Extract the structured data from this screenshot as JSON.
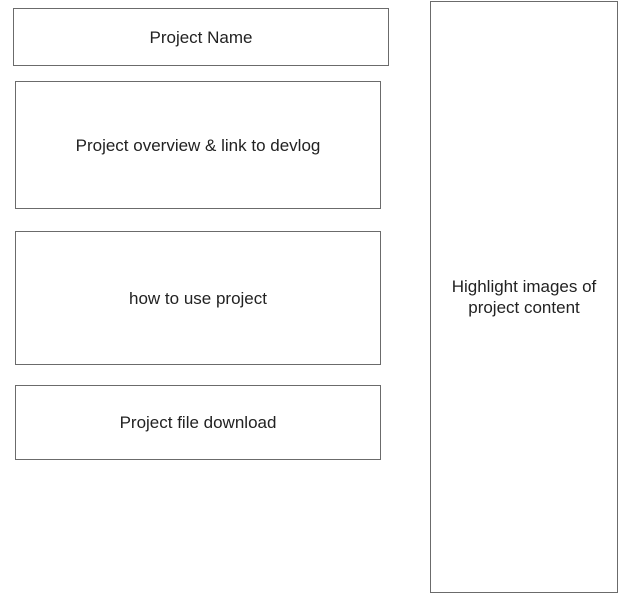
{
  "boxes": {
    "project_name": "Project Name",
    "overview": "Project overview & link to devlog",
    "how_to_use": "how to use project",
    "download": "Project file download",
    "highlight_images": "Highlight images of project content"
  },
  "colors": {
    "border": "#6b6b6b",
    "text": "#222222",
    "background": "#ffffff"
  }
}
